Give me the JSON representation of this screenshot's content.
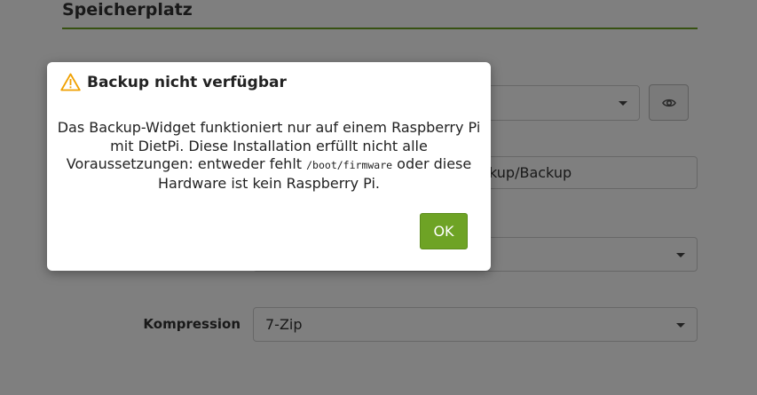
{
  "page": {
    "section_title": "Speicherplatz",
    "backup_path_value": "/mnt/dietpi_userdata/dietpi-backup/Backup",
    "compression_label": "Kompression",
    "compression_value": "7-Zip",
    "accent_color": "#6ea325"
  },
  "dialog": {
    "icon": "warning-icon",
    "title": "Backup nicht verfügbar",
    "message_part1": "Das Backup-Widget funktioniert nur auf einem Raspberry Pi mit DietPi. Diese Installation erfüllt nicht alle Voraussetzungen: entweder fehlt ",
    "message_code": "/boot/firmware",
    "message_part2": " oder diese Hardware ist kein Raspberry Pi.",
    "ok_label": "OK",
    "button_color": "#6ea325"
  }
}
